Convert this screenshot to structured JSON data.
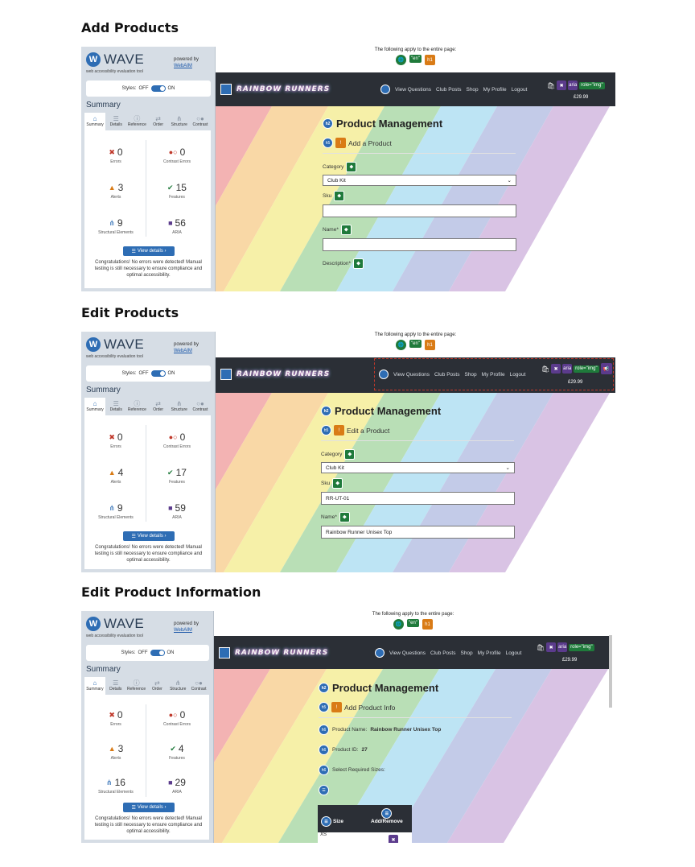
{
  "sections": [
    {
      "title": "Add Products",
      "wave": {
        "tool_name": "WAVE",
        "tagline": "web accessibility evaluation tool",
        "powered_by": "powered by",
        "webaim": "WebAIM",
        "styles_label": "Styles:",
        "off": "OFF",
        "on": "ON",
        "summary_heading": "Summary",
        "tabs": [
          "Summary",
          "Details",
          "Reference",
          "Order",
          "Structure",
          "Contrast"
        ],
        "stats": {
          "errors": {
            "value": "0",
            "label": "Errors"
          },
          "contrast": {
            "value": "0",
            "label": "Contrast Errors"
          },
          "alerts": {
            "value": "3",
            "label": "Alerts"
          },
          "features": {
            "value": "15",
            "label": "Features"
          },
          "structure": {
            "value": "9",
            "label": "Structural Elements"
          },
          "aria": {
            "value": "56",
            "label": "ARIA"
          }
        },
        "view_details": "View details ›",
        "congrats": "Congratulations! No errors were detected! Manual testing is still necessary to ensure compliance and optimal accessibility."
      },
      "page": {
        "applies": "The following apply to the entire page:",
        "lang_badge": "\"en\"",
        "h1_badge": "h1",
        "brand": "RAINBOW RUNNERS",
        "nav_links": [
          "View Questions",
          "Club Posts",
          "Shop",
          "My Profile",
          "Logout"
        ],
        "price": "£29.99",
        "role_badge": "role=\"img\"",
        "aria_badge": "aria",
        "heading": "Product Management",
        "sub_heading": "Add a Product",
        "category_label": "Category",
        "category_value": "Club Kit",
        "sku_label": "Sku",
        "sku_value": "",
        "name_label": "Name*",
        "name_value": "",
        "description_label": "Description*"
      }
    },
    {
      "title": "Edit Products",
      "wave": {
        "stats": {
          "errors": {
            "value": "0",
            "label": "Errors"
          },
          "contrast": {
            "value": "0",
            "label": "Contrast Errors"
          },
          "alerts": {
            "value": "4",
            "label": "Alerts"
          },
          "features": {
            "value": "17",
            "label": "Features"
          },
          "structure": {
            "value": "9",
            "label": "Structural Elements"
          },
          "aria": {
            "value": "59",
            "label": "ARIA"
          }
        }
      },
      "page": {
        "sub_heading": "Edit a Product",
        "category_value": "Club Kit",
        "sku_value": "RR-UT-01",
        "name_value": "Rainbow Runner Unisex Top"
      }
    },
    {
      "title": "Edit Product Information",
      "wave": {
        "stats": {
          "errors": {
            "value": "0",
            "label": "Errors"
          },
          "contrast": {
            "value": "0",
            "label": "Contrast Errors"
          },
          "alerts": {
            "value": "3",
            "label": "Alerts"
          },
          "features": {
            "value": "4",
            "label": "Features"
          },
          "structure": {
            "value": "16",
            "label": "Structural Elements"
          },
          "aria": {
            "value": "29",
            "label": "ARIA"
          }
        }
      },
      "page": {
        "sub_heading": "Add Product Info",
        "product_name_label": "Product Name:",
        "product_name_value": "Rainbow Runner Unisex Top",
        "product_id_label": "Product ID:",
        "product_id_value": "27",
        "sizes_label": "Select Required Sizes:",
        "table_col_size": "Size",
        "table_col_action": "Add/Remove",
        "first_size": "XS",
        "h6_badge": "h6"
      }
    }
  ],
  "colors": {
    "wave_blue": "#2e6db4",
    "nav_dark": "#2b2f36",
    "error_red": "#c0392b",
    "feature_green": "#1f7a3b",
    "alert_orange": "#d97b16",
    "aria_purple": "#5b3b8c"
  }
}
